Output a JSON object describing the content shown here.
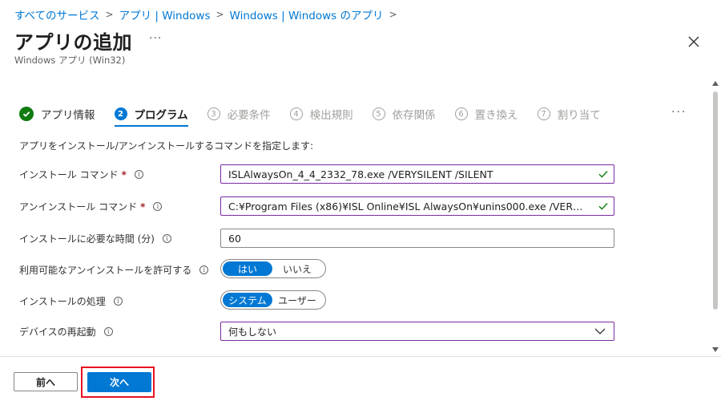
{
  "breadcrumb": [
    "すべてのサービス",
    "アプリ | Windows",
    "Windows | Windows のアプリ"
  ],
  "header": {
    "title": "アプリの追加",
    "subtitle": "Windows アプリ (Win32)",
    "more": "···",
    "close_icon": "close-icon"
  },
  "wizard": {
    "steps": [
      {
        "index": "1",
        "label": "アプリ情報",
        "state": "completed"
      },
      {
        "index": "2",
        "label": "プログラム",
        "state": "active"
      },
      {
        "index": "3",
        "label": "必要条件",
        "state": "pending"
      },
      {
        "index": "4",
        "label": "検出規則",
        "state": "pending"
      },
      {
        "index": "5",
        "label": "依存関係",
        "state": "pending"
      },
      {
        "index": "6",
        "label": "置き換え",
        "state": "pending"
      },
      {
        "index": "7",
        "label": "割り当て",
        "state": "pending"
      }
    ],
    "more": "···"
  },
  "form": {
    "instruction": "アプリをインストール/アンインストールするコマンドを指定します:",
    "install_command": {
      "label": "インストール コマンド",
      "required": "*",
      "value": "ISLAlwaysOn_4_4_2332_78.exe /VERYSILENT /SILENT"
    },
    "uninstall_command": {
      "label": "アンインストール コマンド",
      "required": "*",
      "value": "C:¥Program Files (x86)¥ISL Online¥ISL AlwaysOn¥unins000.exe /VER…"
    },
    "install_time": {
      "label": "インストールに必要な時間 (分)",
      "value": "60"
    },
    "allow_uninstall": {
      "label": "利用可能なアンインストールを許可する",
      "options": [
        "はい",
        "いいえ"
      ],
      "selected": "はい"
    },
    "install_behavior": {
      "label": "インストールの処理",
      "options": [
        "システム",
        "ユーザー"
      ],
      "selected": "システム"
    },
    "device_restart": {
      "label": "デバイスの再起動",
      "value": "何もしない"
    },
    "info_glyph": "i"
  },
  "footer": {
    "prev_label": "前へ",
    "next_label": "次へ"
  },
  "colors": {
    "accent": "#0078d4",
    "success": "#107c10",
    "highlight": "#e81123",
    "valid_border": "#7a2aa0"
  }
}
